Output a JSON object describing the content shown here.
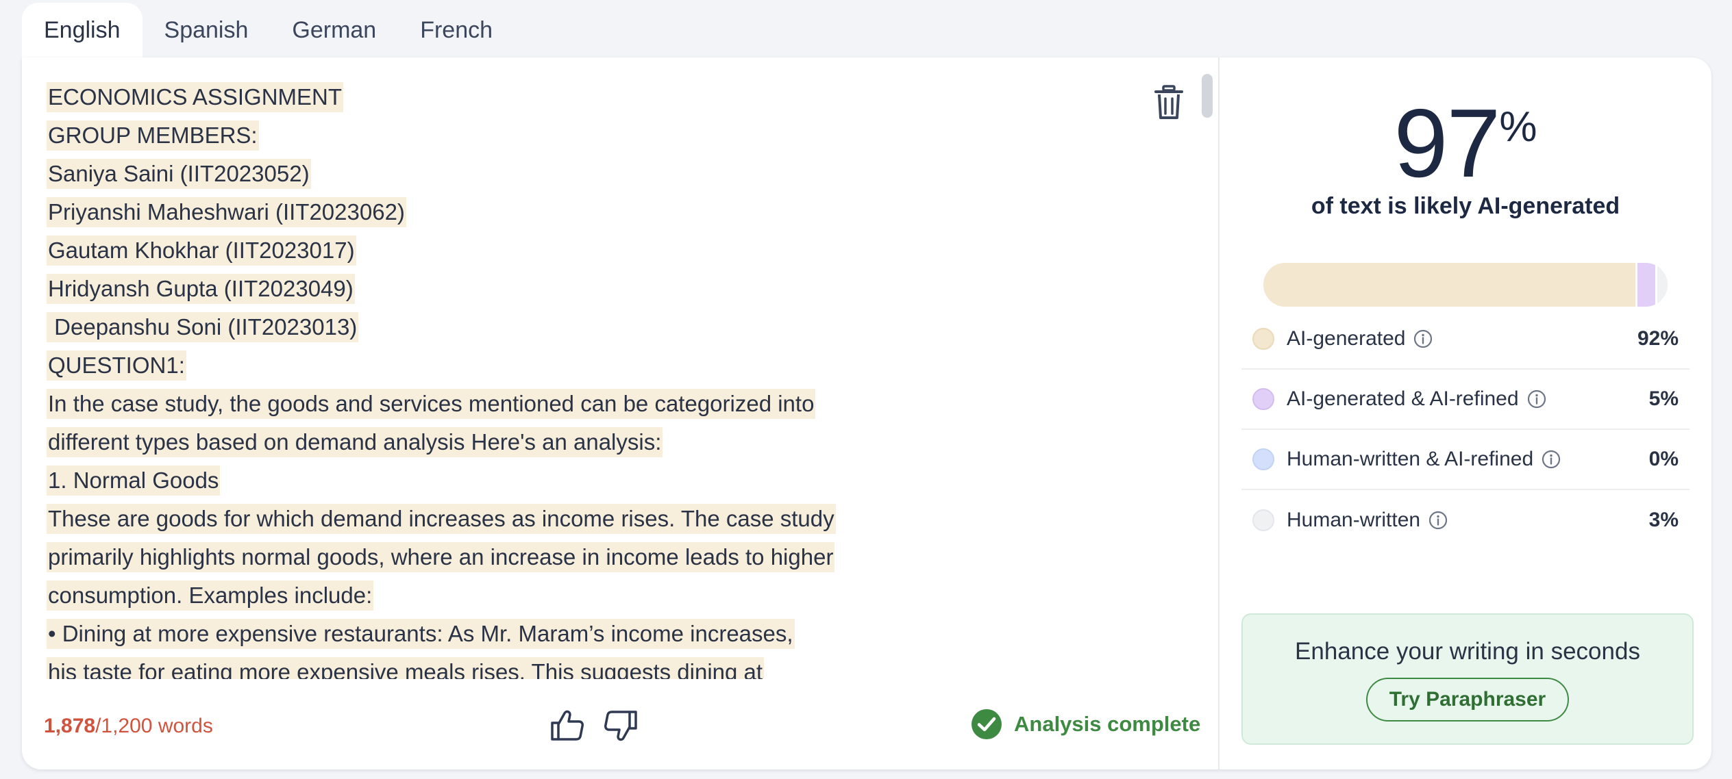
{
  "tabs": [
    {
      "label": "English",
      "active": true
    },
    {
      "label": "Spanish",
      "active": false
    },
    {
      "label": "German",
      "active": false
    },
    {
      "label": "French",
      "active": false
    }
  ],
  "editor": {
    "lines": [
      "ECONOMICS ASSIGNMENT",
      "GROUP MEMBERS:",
      "Saniya Saini (IIT2023052)",
      "Priyanshi Maheshwari (IIT2023062)",
      "Gautam Khokhar (IIT2023017)",
      "Hridyansh Gupta (IIT2023049)",
      " Deepanshu Soni (IIT2023013)",
      "QUESTION1:",
      "In the case study, the goods and services mentioned can be categorized into",
      "different types based on demand analysis Here's an analysis:",
      "1. Normal Goods",
      "These are goods for which demand increases as income rises. The case study",
      "primarily highlights normal goods, where an increase in income leads to higher",
      "consumption. Examples include:",
      "• Dining at more expensive restaurants: As Mr. Maram’s income increases,",
      "his taste for eating more expensive meals rises. This suggests dining at"
    ],
    "delete_icon": "trash-icon"
  },
  "footer": {
    "word_count": "1,878",
    "word_limit": "/1,200 words",
    "status": "Analysis complete",
    "status_color": "#3f8a43",
    "thumbs_up_icon": "thumbs-up-icon",
    "thumbs_down_icon": "thumbs-down-icon"
  },
  "results": {
    "score": "97",
    "score_unit": "%",
    "score_label": "of text is likely AI-generated",
    "breakdown": [
      {
        "label": "AI-generated",
        "value": "92%",
        "fraction": 0.92,
        "color": "#f3e7cf"
      },
      {
        "label": "AI-generated & AI-refined",
        "value": "5%",
        "fraction": 0.05,
        "color": "#e2cff7"
      },
      {
        "label": "Human-written & AI-refined",
        "value": "0%",
        "fraction": 0.0,
        "color": "#d4e0fb"
      },
      {
        "label": "Human-written",
        "value": "3%",
        "fraction": 0.03,
        "color": "#f0f1f3"
      }
    ],
    "promo_title": "Enhance your writing in seconds",
    "promo_button": "Try Paraphraser"
  }
}
